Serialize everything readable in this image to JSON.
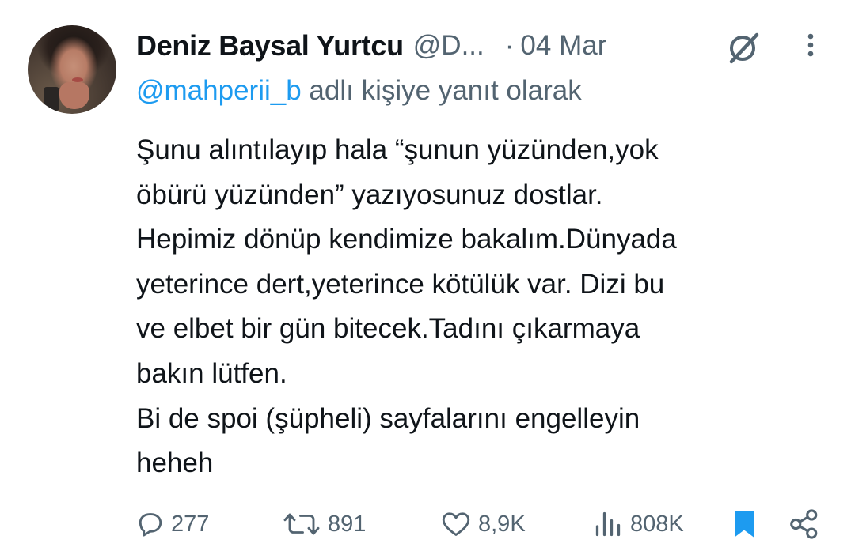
{
  "tweet": {
    "author_name": "Deniz Baysal Yurtcu",
    "author_handle": "@D...",
    "separator": "·",
    "date": "04 Mar",
    "reply_to_handle": "@mahperii_b",
    "reply_to_suffix": "adlı kişiye yanıt olarak",
    "body_lines": [
      "Şunu alıntılayıp hala “şunun yüzünden,yok",
      "öbürü yüzünden” yazıyosunuz dostlar.",
      "Hepimiz dönüp kendimize bakalım.Dünyada",
      "yeterince dert,yeterince kötülük var. Dizi bu",
      "ve elbet bir gün bitecek.Tadını çıkarmaya",
      "bakın lütfen.",
      "Bi de spoi (şüpheli) sayfalarını engelleyin",
      "heheh"
    ]
  },
  "actions": {
    "replies": "277",
    "retweets": "891",
    "likes": "8,9K",
    "views": "808K"
  },
  "icons": {
    "avatar": "profile-photo",
    "grok": "grok-icon",
    "more": "more-vertical-icon",
    "reply": "reply-icon",
    "retweet": "retweet-icon",
    "like": "heart-icon",
    "views": "views-icon",
    "bookmark": "bookmark-icon",
    "share": "share-icon"
  },
  "colors": {
    "text": "#0f1419",
    "secondary": "#536471",
    "link": "#1d9bf0",
    "bookmark": "#1d9bf0"
  }
}
